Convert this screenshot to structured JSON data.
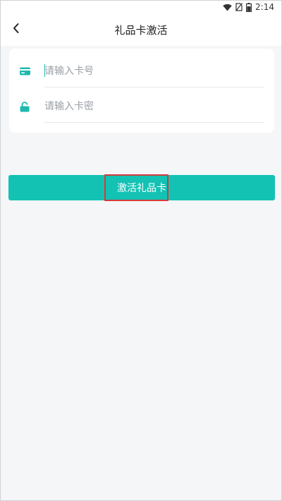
{
  "status_bar": {
    "time": "2:14",
    "icons": [
      "wifi-icon",
      "no-sim-icon",
      "battery-icon"
    ]
  },
  "header": {
    "back_icon": "chevron-left-icon",
    "title": "礼品卡激活"
  },
  "form": {
    "card_number": {
      "icon": "card-icon",
      "placeholder": "请输入卡号",
      "value": ""
    },
    "card_password": {
      "icon": "lock-icon",
      "placeholder": "请输入卡密",
      "value": ""
    }
  },
  "activate_button": {
    "label": "激活礼品卡"
  },
  "colors": {
    "accent": "#14c2b4",
    "background": "#f5f6f8",
    "highlight_box": "#d63a3a"
  }
}
